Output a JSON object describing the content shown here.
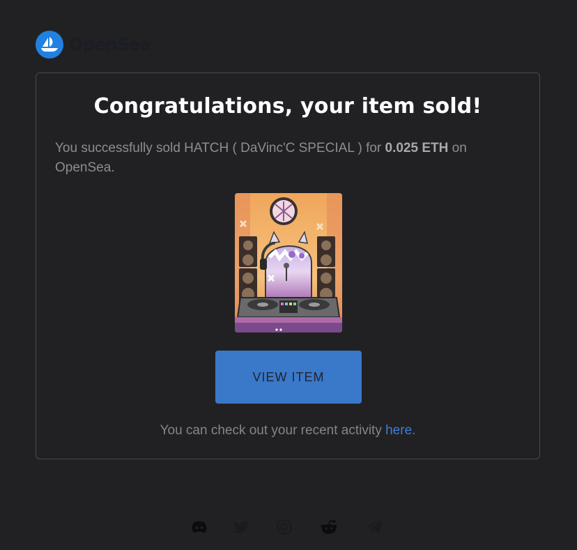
{
  "brand": {
    "name": "OpenSea",
    "accent": "#2081e2"
  },
  "email": {
    "title": "Congratulations, your item sold!",
    "message_prefix": "You successfully sold HATCH ( DaVinc'C SPECIAL ) for ",
    "price": "0.025 ETH",
    "message_suffix": " on OpenSea.",
    "nft_icon": "nft-dj-cat-image",
    "view_button_label": "VIEW ITEM",
    "view_button_color": "#3a78c9",
    "activity_prefix": "You can check out your recent activity ",
    "activity_link_label": "here."
  },
  "social_icons": [
    "discord-icon",
    "twitter-icon",
    "instagram-icon",
    "reddit-icon",
    "telegram-icon"
  ]
}
